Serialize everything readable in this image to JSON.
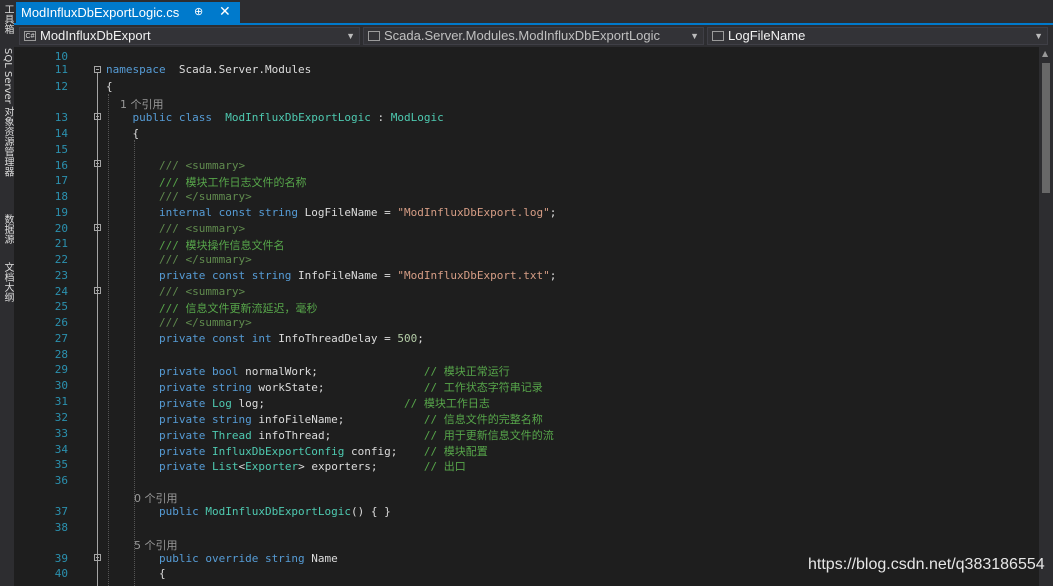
{
  "side_tabs": [
    "工具箱",
    "SQL Server 对象资源管理器",
    "数据源",
    "文档大纲"
  ],
  "tab": {
    "title": "ModInfluxDbExportLogic.cs",
    "pin": "⊕",
    "close": "✕"
  },
  "nav": {
    "project": "ModInfluxDbExport",
    "type": "Scada.Server.Modules.ModInfluxDbExportLogic",
    "member": "LogFileName",
    "project_icon": "C#"
  },
  "code_lines": [
    {
      "n": "10",
      "ref": "",
      "parts": []
    },
    {
      "n": "11",
      "ref": "",
      "parts": [
        [
          "kw",
          "namespace"
        ],
        [
          "",
          "  Scada.Server.Modules"
        ]
      ]
    },
    {
      "n": "12",
      "ref": "",
      "parts": [
        [
          "",
          "{"
        ]
      ]
    },
    {
      "n": "",
      "ref": "    1 个引用",
      "parts": []
    },
    {
      "n": "13",
      "ref": "",
      "parts": [
        [
          "kw",
          "    public class"
        ],
        [
          "",
          "  "
        ],
        [
          "ty",
          "ModInfluxDbExportLogic"
        ],
        [
          "",
          " : "
        ],
        [
          "ty",
          "ModLogic"
        ]
      ]
    },
    {
      "n": "14",
      "ref": "",
      "parts": [
        [
          "",
          "    {"
        ]
      ]
    },
    {
      "n": "15",
      "ref": "",
      "parts": []
    },
    {
      "n": "16",
      "ref": "",
      "parts": [
        [
          "xd",
          "        /// <summary>"
        ]
      ]
    },
    {
      "n": "17",
      "ref": "",
      "parts": [
        [
          "cm",
          "        /// 模块工作日志文件的名称"
        ]
      ]
    },
    {
      "n": "18",
      "ref": "",
      "parts": [
        [
          "xd",
          "        /// </summary>"
        ]
      ]
    },
    {
      "n": "19",
      "ref": "",
      "parts": [
        [
          "kw",
          "        internal const string"
        ],
        [
          "",
          " LogFileName = "
        ],
        [
          "str",
          "\"ModInfluxDbExport.log\""
        ],
        [
          "",
          ";"
        ]
      ]
    },
    {
      "n": "20",
      "ref": "",
      "parts": [
        [
          "xd",
          "        /// <summary>"
        ]
      ]
    },
    {
      "n": "21",
      "ref": "",
      "parts": [
        [
          "cm",
          "        /// 模块操作信息文件名"
        ]
      ]
    },
    {
      "n": "22",
      "ref": "",
      "parts": [
        [
          "xd",
          "        /// </summary>"
        ]
      ]
    },
    {
      "n": "23",
      "ref": "",
      "parts": [
        [
          "kw",
          "        private const string"
        ],
        [
          "",
          " InfoFileName = "
        ],
        [
          "str",
          "\"ModInfluxDbExport.txt\""
        ],
        [
          "",
          ";"
        ]
      ]
    },
    {
      "n": "24",
      "ref": "",
      "parts": [
        [
          "xd",
          "        /// <summary>"
        ]
      ]
    },
    {
      "n": "25",
      "ref": "",
      "parts": [
        [
          "cm",
          "        /// 信息文件更新流延迟，毫秒"
        ]
      ]
    },
    {
      "n": "26",
      "ref": "",
      "parts": [
        [
          "xd",
          "        /// </summary>"
        ]
      ]
    },
    {
      "n": "27",
      "ref": "",
      "parts": [
        [
          "kw",
          "        private const int"
        ],
        [
          "",
          " InfoThreadDelay = "
        ],
        [
          "num",
          "500"
        ],
        [
          "",
          ";"
        ]
      ]
    },
    {
      "n": "28",
      "ref": "",
      "parts": []
    },
    {
      "n": "29",
      "ref": "",
      "parts": [
        [
          "kw",
          "        private bool"
        ],
        [
          "",
          " normalWork;                "
        ],
        [
          "cm",
          "// 模块正常运行"
        ]
      ]
    },
    {
      "n": "30",
      "ref": "",
      "parts": [
        [
          "kw",
          "        private string"
        ],
        [
          "",
          " workState;               "
        ],
        [
          "cm",
          "// 工作状态字符串记录"
        ]
      ]
    },
    {
      "n": "31",
      "ref": "",
      "parts": [
        [
          "kw",
          "        private"
        ],
        [
          " ",
          " "
        ],
        [
          "ty",
          "Log"
        ],
        [
          "",
          " log;                     "
        ],
        [
          "cm",
          "// 模块工作日志"
        ]
      ]
    },
    {
      "n": "32",
      "ref": "",
      "parts": [
        [
          "kw",
          "        private string"
        ],
        [
          "",
          " infoFileName;            "
        ],
        [
          "cm",
          "// 信息文件的完整名称"
        ]
      ]
    },
    {
      "n": "33",
      "ref": "",
      "parts": [
        [
          "kw",
          "        private"
        ],
        [
          "",
          " "
        ],
        [
          "ty",
          "Thread"
        ],
        [
          "",
          " infoThread;              "
        ],
        [
          "cm",
          "// 用于更新信息文件的流"
        ]
      ]
    },
    {
      "n": "34",
      "ref": "",
      "parts": [
        [
          "kw",
          "        private"
        ],
        [
          "",
          " "
        ],
        [
          "ty",
          "InfluxDbExportConfig"
        ],
        [
          "",
          " config;    "
        ],
        [
          "cm",
          "// 模块配置"
        ]
      ]
    },
    {
      "n": "35",
      "ref": "",
      "parts": [
        [
          "kw",
          "        private"
        ],
        [
          "",
          " "
        ],
        [
          "ty",
          "List"
        ],
        [
          "",
          "<"
        ],
        [
          "ty",
          "Exporter"
        ],
        [
          "",
          "> exporters;       "
        ],
        [
          "cm",
          "// 出口"
        ]
      ]
    },
    {
      "n": "36",
      "ref": "",
      "parts": []
    },
    {
      "n": "",
      "ref": "        0 个引用",
      "parts": []
    },
    {
      "n": "37",
      "ref": "",
      "parts": [
        [
          "kw",
          "        public"
        ],
        [
          "",
          " "
        ],
        [
          "ty",
          "ModInfluxDbExportLogic"
        ],
        [
          "",
          "() { }"
        ]
      ]
    },
    {
      "n": "38",
      "ref": "",
      "parts": []
    },
    {
      "n": "",
      "ref": "        5 个引用",
      "parts": []
    },
    {
      "n": "39",
      "ref": "",
      "parts": [
        [
          "kw",
          "        public override string"
        ],
        [
          "",
          " Name"
        ]
      ]
    },
    {
      "n": "40",
      "ref": "",
      "parts": [
        [
          "",
          "        {"
        ]
      ]
    }
  ],
  "watermark": "https://blog.csdn.net/q383186554"
}
